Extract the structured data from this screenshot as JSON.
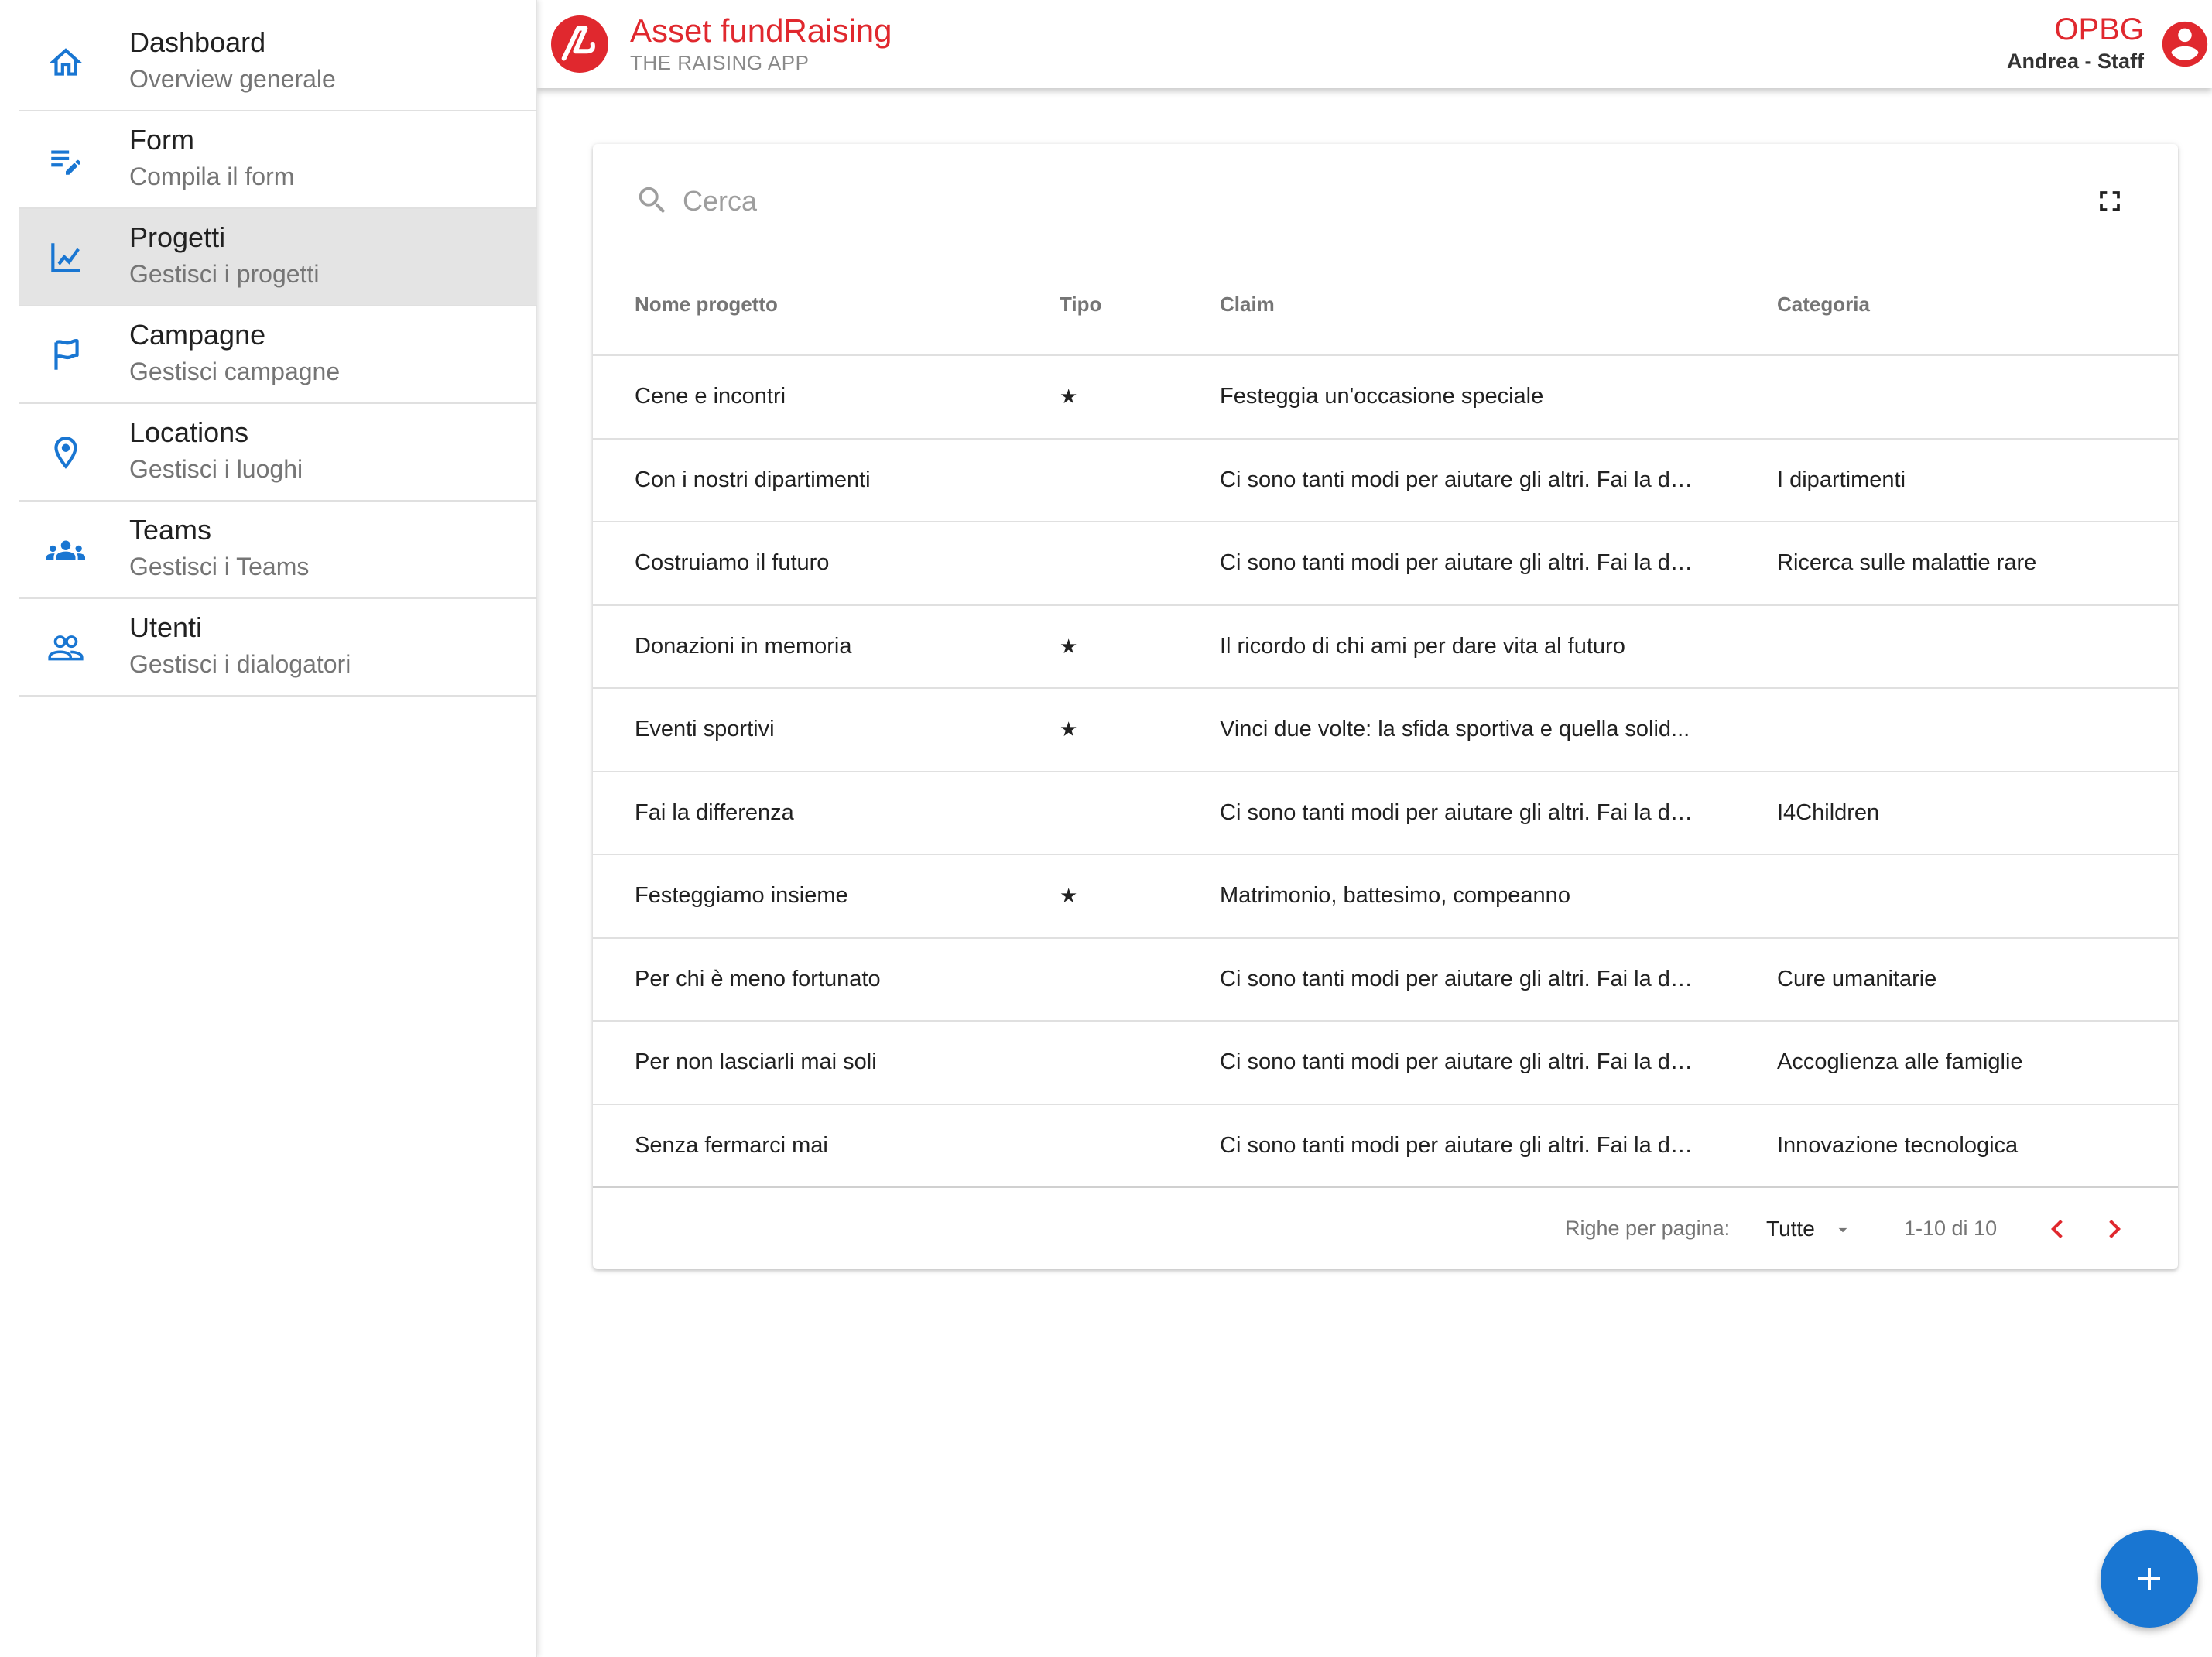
{
  "header": {
    "app_title": "Asset fundRaising",
    "app_subtitle": "THE RAISING APP",
    "org": "OPBG",
    "user": "Andrea - Staff"
  },
  "sidebar": {
    "items": [
      {
        "title": "Dashboard",
        "subtitle": "Overview generale",
        "icon": "home-icon"
      },
      {
        "title": "Form",
        "subtitle": "Compila il form",
        "icon": "edit-note-icon"
      },
      {
        "title": "Progetti",
        "subtitle": "Gestisci i progetti",
        "icon": "chart-line-icon",
        "active": true
      },
      {
        "title": "Campagne",
        "subtitle": "Gestisci campagne",
        "icon": "flag-icon"
      },
      {
        "title": "Locations",
        "subtitle": "Gestisci i luoghi",
        "icon": "location-pin-icon"
      },
      {
        "title": "Teams",
        "subtitle": "Gestisci i Teams",
        "icon": "groups-icon"
      },
      {
        "title": "Utenti",
        "subtitle": "Gestisci i dialogatori",
        "icon": "people-outline-icon"
      }
    ]
  },
  "search": {
    "placeholder": "Cerca",
    "value": ""
  },
  "table": {
    "headers": {
      "name": "Nome progetto",
      "tipo": "Tipo",
      "claim": "Claim",
      "categoria": "Categoria"
    },
    "rows": [
      {
        "name": "Cene e incontri",
        "tipo": "★",
        "claim": "Festeggia un'occasione speciale",
        "categoria": ""
      },
      {
        "name": "Con i nostri dipartimenti",
        "tipo": "",
        "claim": "Ci sono tanti modi per aiutare gli altri. Fai la di...",
        "categoria": "I dipartimenti"
      },
      {
        "name": "Costruiamo il futuro",
        "tipo": "",
        "claim": "Ci sono tanti modi per aiutare gli altri. Fai la di...",
        "categoria": "Ricerca sulle malattie rare"
      },
      {
        "name": "Donazioni in memoria",
        "tipo": "★",
        "claim": "Il ricordo di chi ami per dare vita al futuro",
        "categoria": ""
      },
      {
        "name": "Eventi sportivi",
        "tipo": "★",
        "claim": "Vinci due volte: la sfida sportiva e quella solid...",
        "categoria": ""
      },
      {
        "name": "Fai la differenza",
        "tipo": "",
        "claim": "Ci sono tanti modi per aiutare gli altri. Fai la di...",
        "categoria": "I4Children"
      },
      {
        "name": "Festeggiamo insieme",
        "tipo": "★",
        "claim": "Matrimonio, battesimo, compeanno",
        "categoria": ""
      },
      {
        "name": "Per chi è meno fortunato",
        "tipo": "",
        "claim": "Ci sono tanti modi per aiutare gli altri. Fai la di...",
        "categoria": "Cure umanitarie"
      },
      {
        "name": "Per non lasciarli mai soli",
        "tipo": "",
        "claim": "Ci sono tanti modi per aiutare gli altri. Fai la di...",
        "categoria": "Accoglienza alle famiglie"
      },
      {
        "name": "Senza fermarci mai",
        "tipo": "",
        "claim": "Ci sono tanti modi per aiutare gli altri. Fai la di...",
        "categoria": "Innovazione tecnologica"
      }
    ]
  },
  "pagination": {
    "rows_per_page_label": "Righe per pagina:",
    "rows_per_page_value": "Tutte",
    "range": "1-10 di 10"
  },
  "colors": {
    "brand_red": "#e0282e",
    "primary_blue": "#1976d2",
    "active_item_bg": "#e4e4e4"
  },
  "fab": {
    "icon": "plus-icon"
  }
}
